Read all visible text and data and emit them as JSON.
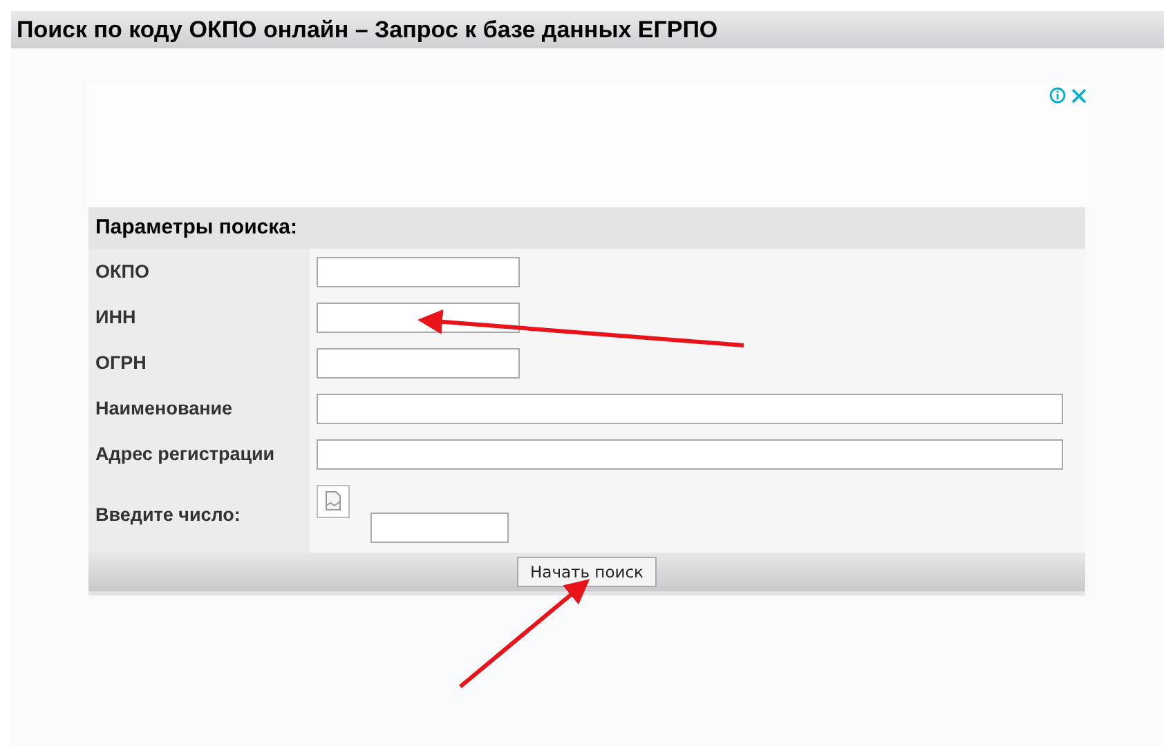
{
  "page_title": "Поиск по коду ОКПО онлайн – Запрос к базе данных ЕГРПО",
  "ad": {
    "kind": "blank"
  },
  "form": {
    "title": "Параметры поиска:",
    "fields": [
      {
        "label": "ОКПО",
        "kind": "short"
      },
      {
        "label": "ИНН",
        "kind": "short"
      },
      {
        "label": "ОГРН",
        "kind": "short"
      },
      {
        "label": "Наименование",
        "kind": "long"
      },
      {
        "label": "Адрес регистрации",
        "kind": "long"
      },
      {
        "label": "Введите число:",
        "kind": "captcha"
      }
    ],
    "submit": "Начать поиск"
  }
}
